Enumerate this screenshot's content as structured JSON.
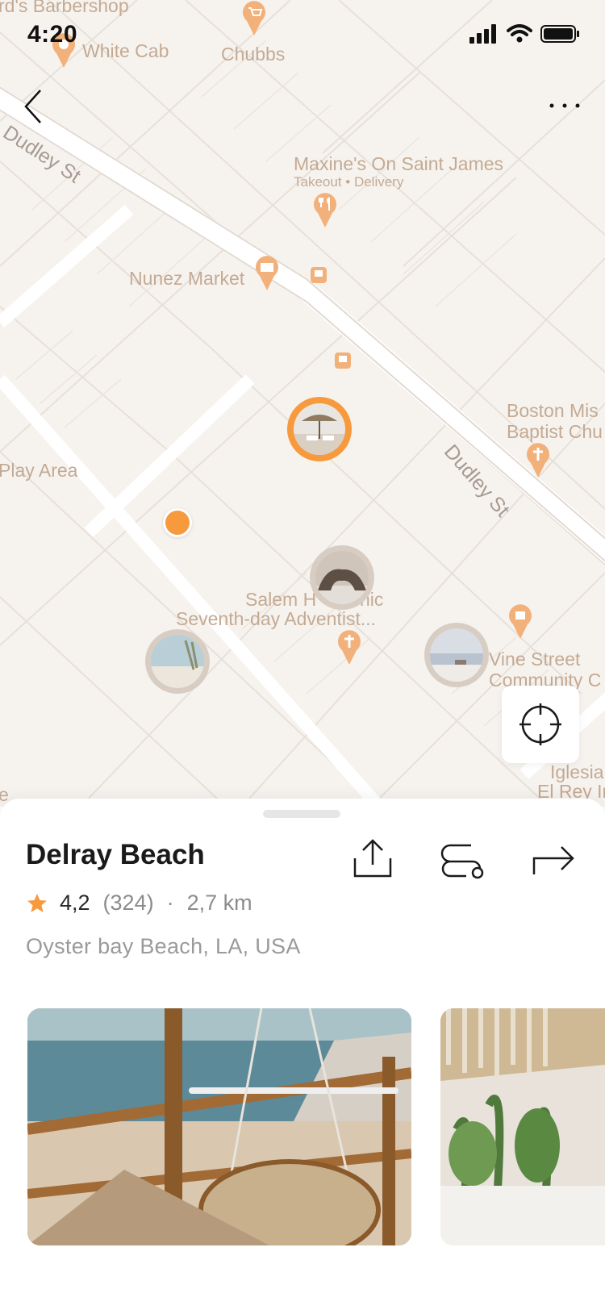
{
  "status_bar": {
    "time": "4:20"
  },
  "map": {
    "pois": [
      {
        "name": "rd's Barbershop"
      },
      {
        "name": "White Cab"
      },
      {
        "name": "Chubbs"
      },
      {
        "name": "Maxine's On Saint James"
      },
      {
        "name": "Takeout • Delivery"
      },
      {
        "name": "Nunez Market"
      },
      {
        "name": "Boston Mis"
      },
      {
        "name": "Baptist Chu"
      },
      {
        "name": "Play Area"
      },
      {
        "name": "Salem H"
      },
      {
        "name": "nic"
      },
      {
        "name": "Seventh-day Adventist..."
      },
      {
        "name": "Vine Street"
      },
      {
        "name": "Community C"
      },
      {
        "name": "Iglesia"
      },
      {
        "name": "El Rey In"
      },
      {
        "name": "e"
      }
    ],
    "streets": [
      "Dudley St",
      "Dudley St"
    ]
  },
  "place": {
    "name": "Delray Beach",
    "rating": "4,2",
    "reviews": "(324)",
    "separator": "·",
    "distance": "2,7 km",
    "address": "Oyster bay Beach, LA, USA"
  },
  "colors": {
    "accent": "#f79a3e",
    "map_bg": "#f6f3ef",
    "poi_text": "#c4aa93"
  }
}
